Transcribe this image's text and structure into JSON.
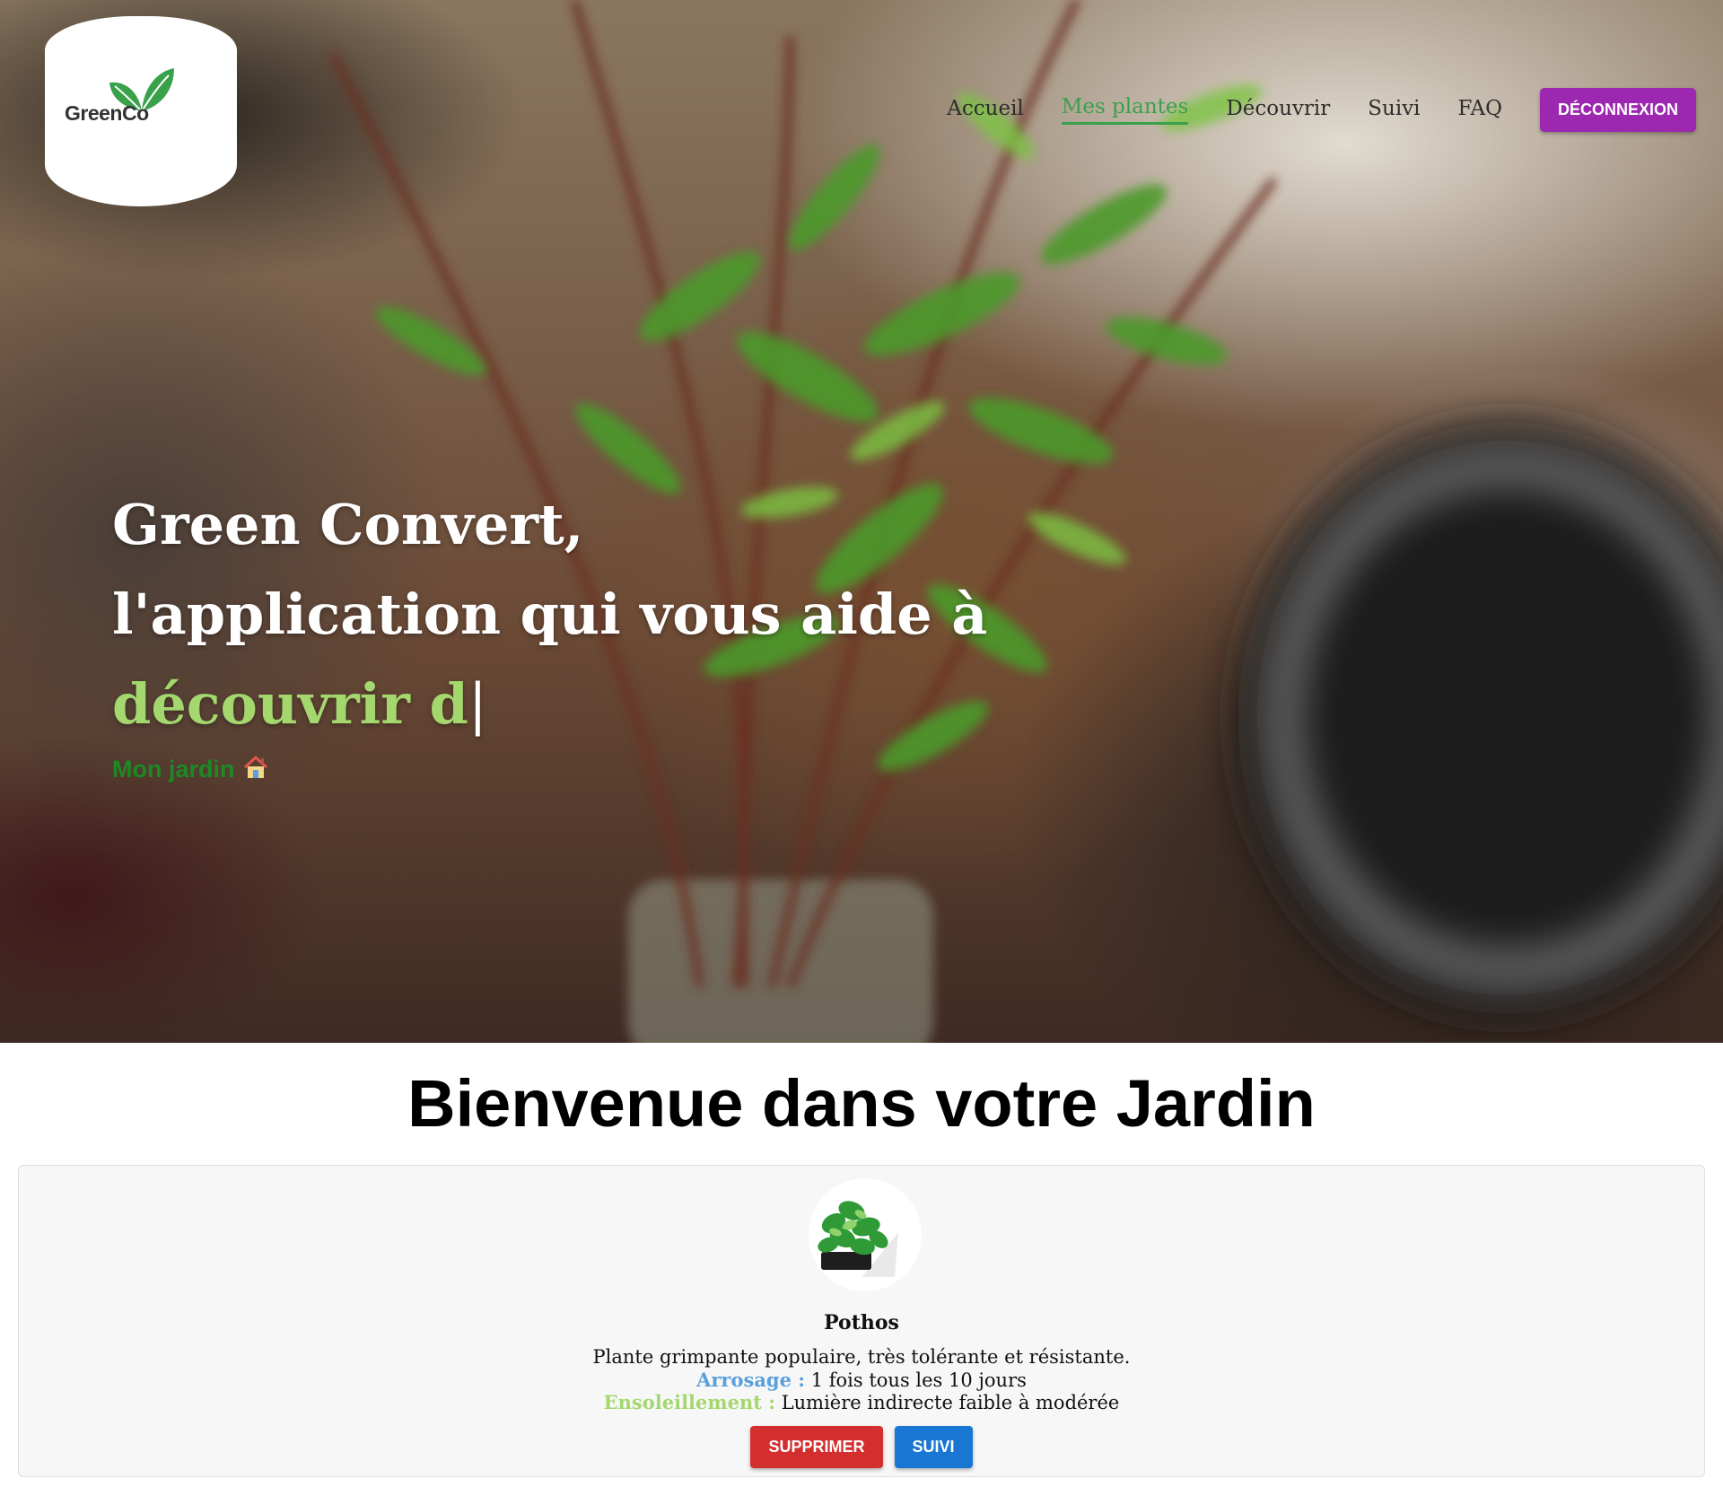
{
  "header": {
    "logo_text": "GreenCo",
    "nav": [
      {
        "label": "Accueil"
      },
      {
        "label": "Mes plantes",
        "active": true
      },
      {
        "label": "Découvrir"
      },
      {
        "label": "Suivi"
      },
      {
        "label": "FAQ"
      }
    ],
    "logout_label": "DÉCONNEXION"
  },
  "hero": {
    "line1": "Green Convert,",
    "line2": "l'application qui vous aide à",
    "typed_text": "découvrir d",
    "caret": "|",
    "garden_link": "Mon jardin",
    "garden_icon": "house-icon"
  },
  "main": {
    "title": "Bienvenue dans votre Jardin",
    "plants": [
      {
        "name": "Pothos",
        "description": "Plante grimpante populaire, très tolérante et résistante.",
        "watering_label": "Arrosage :",
        "watering_value": "1 fois tous les 10 jours",
        "sun_label": "Ensoleillement :",
        "sun_value": "Lumière indirecte faible à modérée",
        "delete_label": "SUPPRIMER",
        "follow_label": "SUIVI"
      }
    ]
  },
  "colors": {
    "accent_purple": "#9c27b0",
    "nav_active": "#3aa14b",
    "hero_accent": "#a4d86e",
    "garden_link": "#1c8a24",
    "delete_red": "#d32f2f",
    "follow_blue": "#1976d2",
    "watering_blue": "#5aa0dc"
  }
}
